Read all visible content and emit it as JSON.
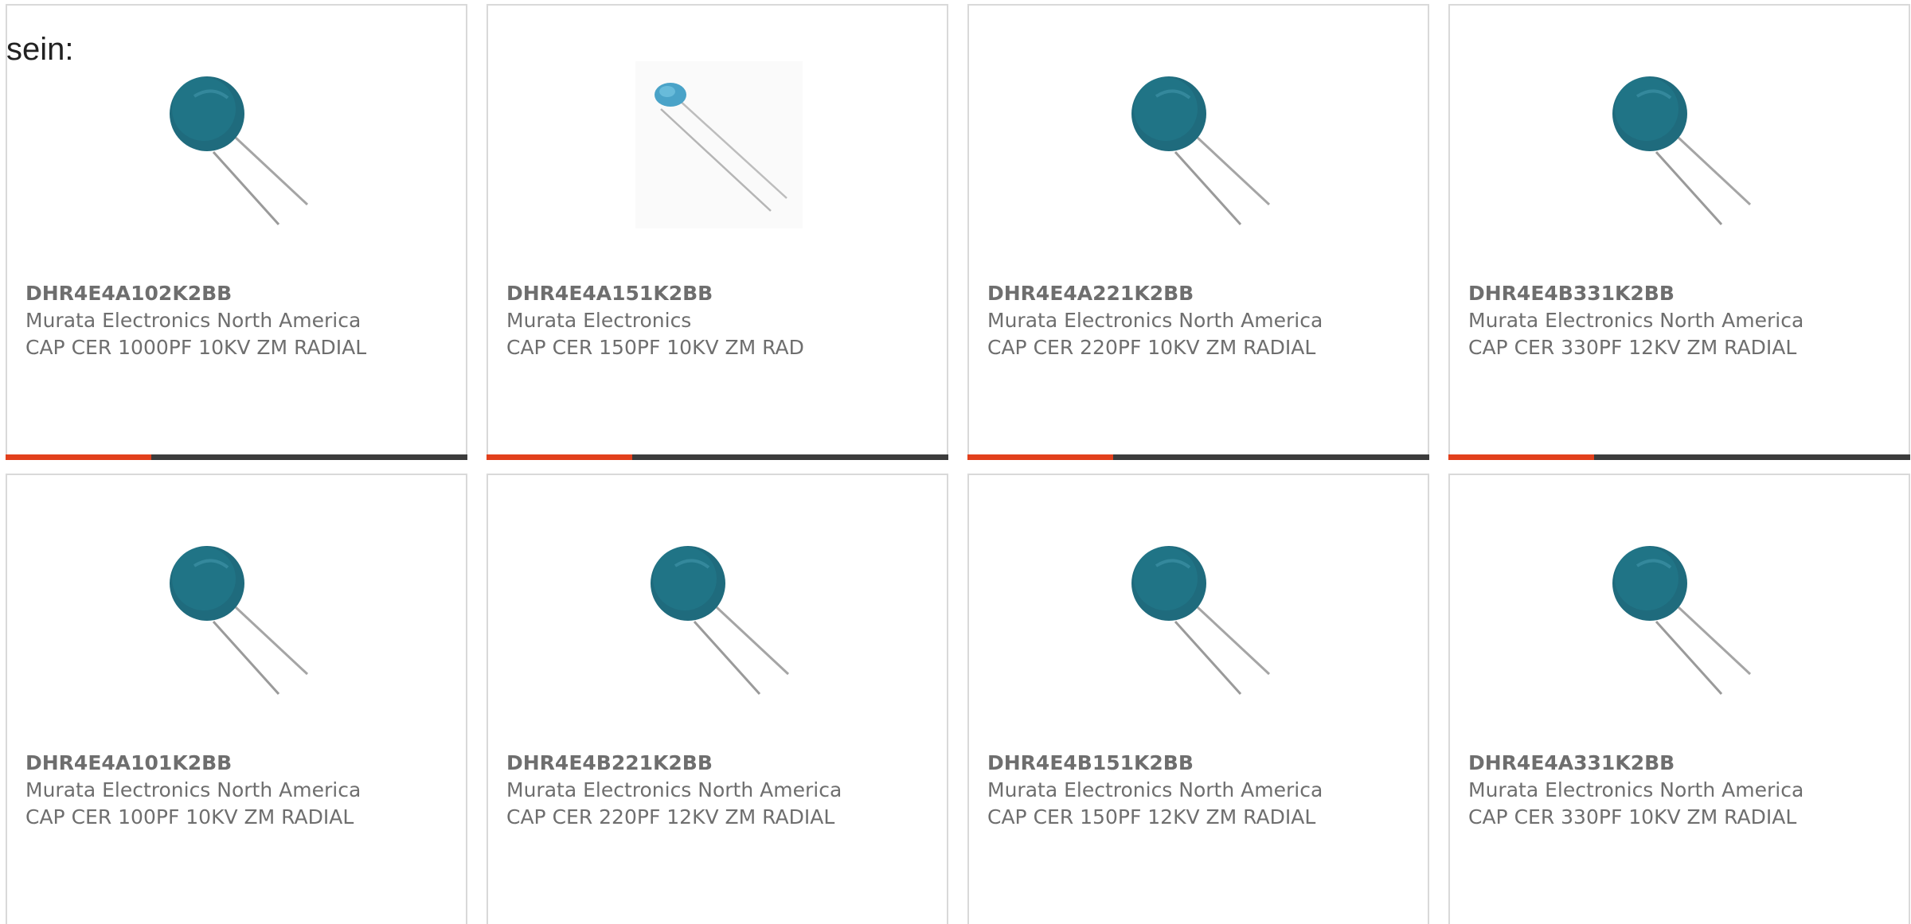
{
  "intro_text": "sein:",
  "colors": {
    "accent": "#e2401c",
    "bar": "#3c3c3c",
    "border": "#d9d9d9",
    "text": "#6e6e6e",
    "capacitor_body": "#1f6b7d",
    "capacitor_small": "#4aa3c8"
  },
  "products": [
    {
      "part_number": "DHR4E4A102K2BB",
      "manufacturer": "Murata Electronics North America",
      "description": "CAP CER 1000PF 10KV ZM RADIAL",
      "image_icon": "disc-capacitor-icon"
    },
    {
      "part_number": "DHR4E4A151K2BB",
      "manufacturer": "Murata Electronics",
      "description": "CAP CER 150PF 10KV ZM RAD",
      "image_icon": "small-capacitor-icon"
    },
    {
      "part_number": "DHR4E4A221K2BB",
      "manufacturer": "Murata Electronics North America",
      "description": "CAP CER 220PF 10KV ZM RADIAL",
      "image_icon": "disc-capacitor-icon"
    },
    {
      "part_number": "DHR4E4B331K2BB",
      "manufacturer": "Murata Electronics North America",
      "description": "CAP CER 330PF 12KV ZM RADIAL",
      "image_icon": "disc-capacitor-icon"
    },
    {
      "part_number": "DHR4E4A101K2BB",
      "manufacturer": "Murata Electronics North America",
      "description": "CAP CER 100PF 10KV ZM RADIAL",
      "image_icon": "disc-capacitor-icon"
    },
    {
      "part_number": "DHR4E4B221K2BB",
      "manufacturer": "Murata Electronics North America",
      "description": "CAP CER 220PF 12KV ZM RADIAL",
      "image_icon": "disc-capacitor-icon"
    },
    {
      "part_number": "DHR4E4B151K2BB",
      "manufacturer": "Murata Electronics North America",
      "description": "CAP CER 150PF 12KV ZM RADIAL",
      "image_icon": "disc-capacitor-icon"
    },
    {
      "part_number": "DHR4E4A331K2BB",
      "manufacturer": "Murata Electronics North America",
      "description": "CAP CER 330PF 10KV ZM RADIAL",
      "image_icon": "disc-capacitor-icon"
    }
  ]
}
